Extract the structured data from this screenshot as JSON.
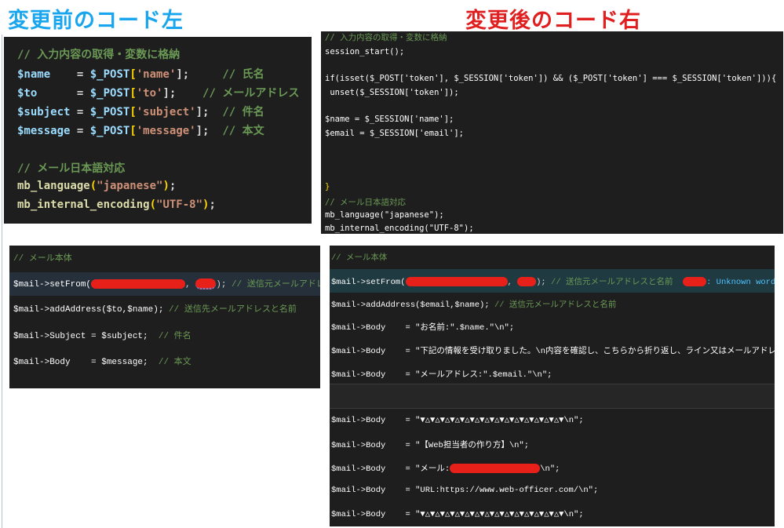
{
  "headings": {
    "left": "変更前のコード左",
    "right": "変更後のコード右"
  },
  "panel1": {
    "comment_input": "// 入力内容の取得・変数に格納",
    "line_name_var": "$name",
    "line_name_mid": "    = ",
    "line_name_post": "$_POST",
    "line_name_key": "'name'",
    "line_name_end": "];",
    "line_name_comment": "     // 氏名",
    "line_to_var": "$to",
    "line_to_mid": "      = ",
    "line_to_post": "$_POST",
    "line_to_key": "'to'",
    "line_to_end": "];",
    "line_to_comment": "    // メールアドレス",
    "line_subject_var": "$subject",
    "line_subject_mid": " = ",
    "line_subject_post": "$_POST",
    "line_subject_key": "'subject'",
    "line_subject_end": "];",
    "line_subject_comment": "  // 件名",
    "line_message_var": "$message",
    "line_message_mid": " = ",
    "line_message_post": "$_POST",
    "line_message_key": "'message'",
    "line_message_end": "];",
    "line_message_comment": "  // 本文",
    "comment_lang": "// メール日本語対応",
    "lang_fn": "mb_language",
    "lang_arg": "\"japanese\"",
    "enc_fn": "mb_internal_encoding",
    "enc_arg": "\"UTF-8\""
  },
  "panel2": {
    "comment_input": "// 入力内容の取得・変数に格納",
    "session_start": "session_start();",
    "if_line": "if(isset($_POST['token'], $_SESSION['token']) && ($_POST['token'] === $_SESSION['token'])){",
    "unset_line": " unset($_SESSION['token']);",
    "name_line": "$name = $_SESSION['name'];",
    "email_line": "$email = $_SESSION['email'];",
    "close_brace": "}",
    "comment_lang": "// メール日本語対応",
    "lang_line": "mb_language(\"japanese\");",
    "enc_line": "mb_internal_encoding(\"UTF-8\");"
  },
  "panel3": {
    "comment_body": "// メール本体",
    "setfrom_prefix": "$mail->setFrom(",
    "setfrom_suffix": ");",
    "setfrom_comment": " // 送信元メールアドレスと名前",
    "addaddress_line": "$mail->addAddress($to,$name);",
    "addaddress_comment": " // 送信先メールアドレスと名前",
    "subject_line": "$mail->Subject = $subject;",
    "subject_comment": "  // 件名",
    "body_line": "$mail->Body    = $message;",
    "body_comment": "  // 本文"
  },
  "panel4": {
    "comment_body": "// メール本体",
    "setfrom_prefix": "$mail->setFrom(",
    "setfrom_suffix": ");",
    "setfrom_comment": " // 送信元メールアドレスと名前",
    "warning": ": Unknown word.",
    "addaddress_line": "$mail->addAddress($email,$name);",
    "addaddress_comment": " // 送信元メールアドレスと名前",
    "body1": "$mail->Body    = \"お名前:\".$name.\"\\n\";",
    "body2": "$mail->Body    = \"下記の情報を受け取りました。\\n内容を確認し、こちらから折り返し、ライン又はメールアドレスにてご案内させて頂きます。\\n\\n\";",
    "body3": "$mail->Body    = \"メールアドレス:\".$email.\"\\n\";",
    "body4": "$mail->Body    = \"▼△▼△▼△▼△▼△▼△▼△▼△▼△▼△▼△▼△▼△▼△▼\\n\";",
    "body5": "$mail->Body    = \"【Web担当者の作り方】\\n\";",
    "body6_prefix": "$mail->Body    = \"メール:",
    "body6_suffix": "\\n\";",
    "body7": "$mail->Body    = \"URL:https://www.web-officer.com/\\n\";",
    "body8": "$mail->Body    = \"▼△▼△▼△▼△▼△▼△▼△▼△▼△▼△▼△▼△▼△▼△▼\\n\";"
  }
}
